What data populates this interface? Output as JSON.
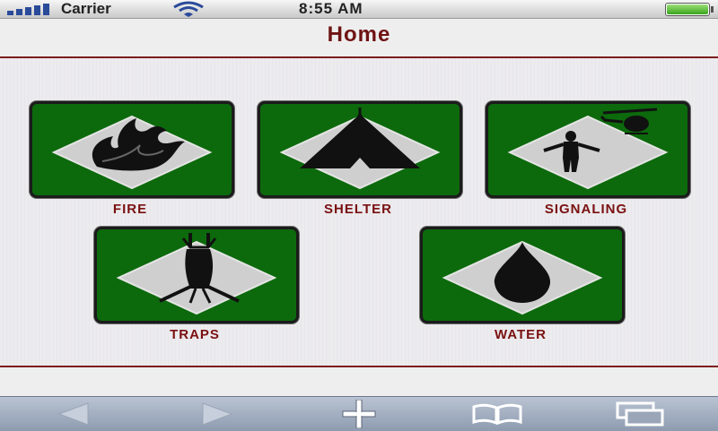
{
  "status_bar": {
    "carrier": "Carrier",
    "time": "8:55 AM"
  },
  "header": {
    "title": "Home"
  },
  "tiles": [
    {
      "label": "FIRE",
      "icon": "fire-icon"
    },
    {
      "label": "SHELTER",
      "icon": "tent-icon"
    },
    {
      "label": "SIGNALING",
      "icon": "signaling-person-helicopter-icon"
    },
    {
      "label": "TRAPS",
      "icon": "trap-icon"
    },
    {
      "label": "WATER",
      "icon": "water-drop-icon"
    }
  ],
  "toolbar": {
    "buttons": [
      "back-icon",
      "forward-icon",
      "add-icon",
      "bookmarks-icon",
      "pages-icon"
    ]
  },
  "colors": {
    "tile_green": "#0c6a0c",
    "accent_red": "#7a1010"
  }
}
